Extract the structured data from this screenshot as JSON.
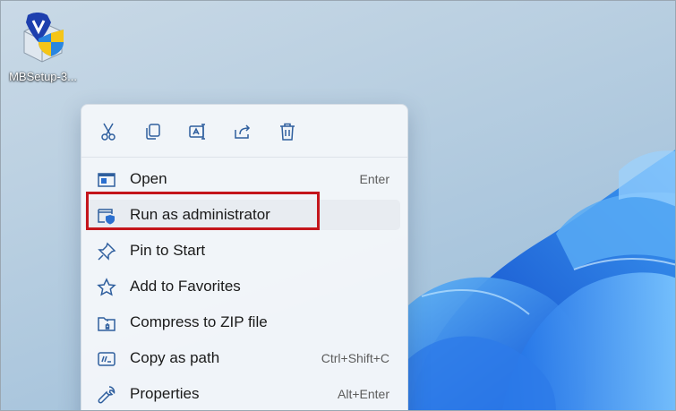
{
  "desktop": {
    "icon": {
      "name": "malwarebytes-installer-icon",
      "label": "MBSetup-3..."
    }
  },
  "context_menu": {
    "actions": [
      {
        "name": "cut-icon",
        "tooltip": "Cut"
      },
      {
        "name": "copy-icon",
        "tooltip": "Copy"
      },
      {
        "name": "rename-icon",
        "tooltip": "Rename"
      },
      {
        "name": "share-icon",
        "tooltip": "Share"
      },
      {
        "name": "delete-icon",
        "tooltip": "Delete"
      }
    ],
    "items": [
      {
        "label": "Open",
        "shortcut": "Enter",
        "icon": "open-app-icon"
      },
      {
        "label": "Run as administrator",
        "shortcut": "",
        "icon": "shield-window-icon",
        "highlighted": true
      },
      {
        "label": "Pin to Start",
        "shortcut": "",
        "icon": "pin-icon"
      },
      {
        "label": "Add to Favorites",
        "shortcut": "",
        "icon": "star-icon"
      },
      {
        "label": "Compress to ZIP file",
        "shortcut": "",
        "icon": "zip-folder-icon"
      },
      {
        "label": "Copy as path",
        "shortcut": "Ctrl+Shift+C",
        "icon": "copy-path-icon"
      },
      {
        "label": "Properties",
        "shortcut": "Alt+Enter",
        "icon": "wrench-icon"
      }
    ]
  },
  "colors": {
    "accent": "#2b6fcf",
    "highlight_border": "#c4161c",
    "icon_stroke": "#2f5f9e"
  }
}
